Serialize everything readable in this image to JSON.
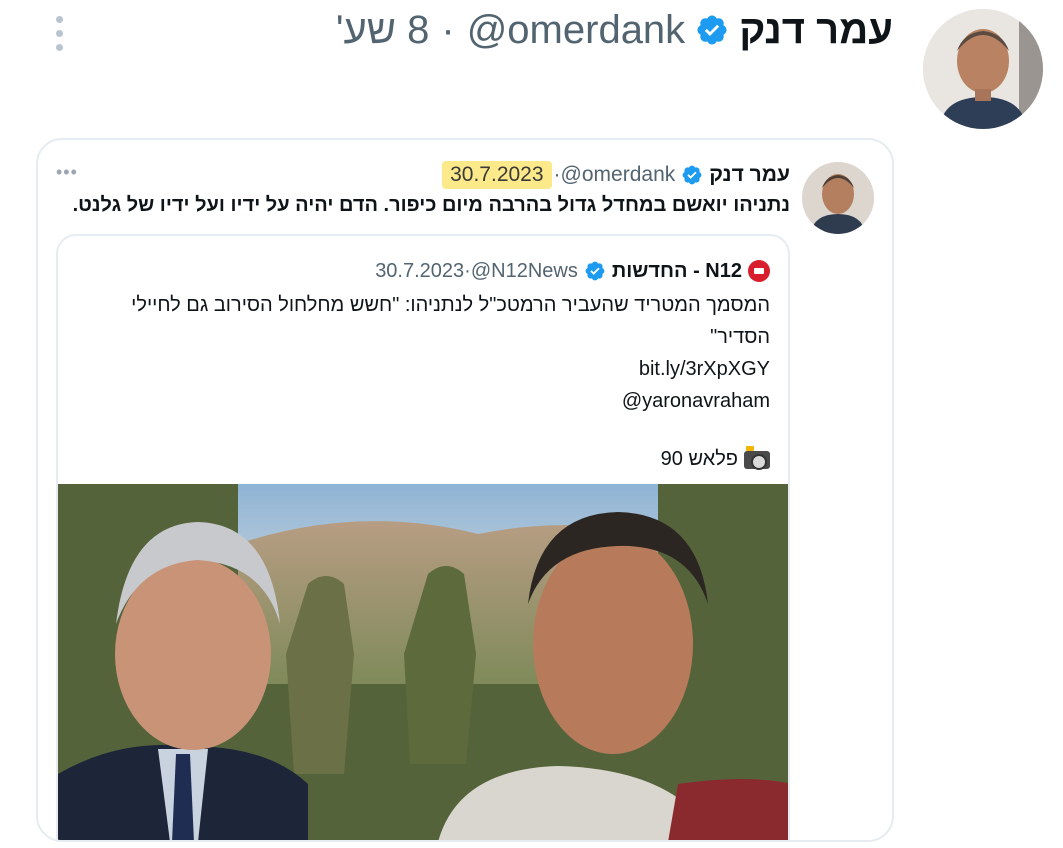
{
  "tweet": {
    "author_name": "עמר דנק",
    "handle": "@omerdank",
    "separator": "·",
    "time": "8 שע'",
    "more_icon": "ellipsis-vertical-icon",
    "verified_icon": "verified-badge-icon"
  },
  "quoted": {
    "author_name": "עמר דנק",
    "handle": "@omerdank",
    "separator": "·",
    "date": "30.7.2023",
    "text_part1": "נתניהו יואשם במחדל גדול בהרבה מיום ",
    "text_bold": "כיפור",
    "text_part2": ". הדם יהיה על ידיו ועל ידיו של גלנט.",
    "more_icon": "ellipsis-horizontal-icon",
    "highlight_color": "#fbe98a"
  },
  "nested": {
    "brand": "N12 - החדשות",
    "handle": "@N12News",
    "separator": "·",
    "date": "30.7.2023",
    "line1": "המסמך המטריד שהעביר הרמטכ\"ל לנתניהו: \"חשש מחלחול הסירוב גם לחיילי",
    "line2": "הסדיר\"",
    "link": "bit.ly/3rXpXGY",
    "mention": "@yaronavraham",
    "flash": "פלאש 90",
    "logo_icon": "n12-logo-icon",
    "flash_icon": "camera-flash-icon"
  },
  "colors": {
    "verified": "#1d9bf0",
    "secondary_text": "#536471",
    "n12_red": "#d81e2d",
    "border": "#e6ecf0"
  }
}
